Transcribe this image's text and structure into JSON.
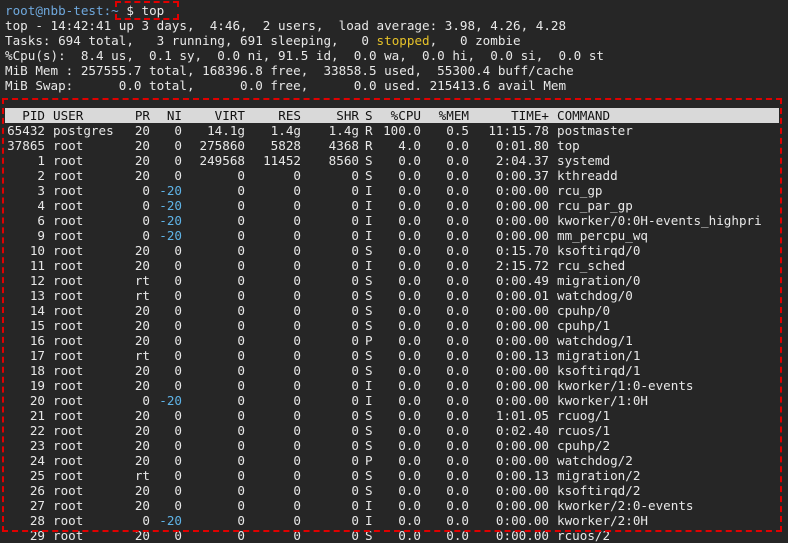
{
  "terminal": {
    "prompt": "root@nbb-test:~",
    "prompt_symbol": "$",
    "command": "top"
  },
  "summary": {
    "line1": "top - 14:42:41 up 3 days,  4:46,  2 users,  load average: 3.98, 4.26, 4.28",
    "line2_a": "Tasks: 694 total,   3 running, 691 sleeping,   0 ",
    "line2_b": "stopped",
    "line2_c": ",   0 zombie",
    "line3": "%Cpu(s):  8.4 us,  0.1 sy,  0.0 ni, 91.5 id,  0.0 wa,  0.0 hi,  0.0 si,  0.0 st",
    "line4": "MiB Mem : 257555.7 total, 168396.8 free,  33858.5 used,  55300.4 buff/cache",
    "line5": "MiB Swap:      0.0 total,      0.0 free,      0.0 used. 215413.6 avail Mem"
  },
  "headers": [
    "PID",
    "USER",
    "PR",
    "NI",
    "VIRT",
    "RES",
    "SHR",
    "S",
    "%CPU",
    "%MEM",
    "TIME+",
    "COMMAND"
  ],
  "processes": [
    [
      "65432",
      "postgres",
      "20",
      "0",
      "14.1g",
      "1.4g",
      "1.4g",
      "R",
      "100.0",
      "0.5",
      "11:15.78",
      "postmaster"
    ],
    [
      "37865",
      "root",
      "20",
      "0",
      "275860",
      "5828",
      "4368",
      "R",
      "4.0",
      "0.0",
      "0:01.80",
      "top"
    ],
    [
      "1",
      "root",
      "20",
      "0",
      "249568",
      "11452",
      "8560",
      "S",
      "0.0",
      "0.0",
      "2:04.37",
      "systemd"
    ],
    [
      "2",
      "root",
      "20",
      "0",
      "0",
      "0",
      "0",
      "S",
      "0.0",
      "0.0",
      "0:00.37",
      "kthreadd"
    ],
    [
      "3",
      "root",
      "0",
      "-20",
      "0",
      "0",
      "0",
      "I",
      "0.0",
      "0.0",
      "0:00.00",
      "rcu_gp"
    ],
    [
      "4",
      "root",
      "0",
      "-20",
      "0",
      "0",
      "0",
      "I",
      "0.0",
      "0.0",
      "0:00.00",
      "rcu_par_gp"
    ],
    [
      "6",
      "root",
      "0",
      "-20",
      "0",
      "0",
      "0",
      "I",
      "0.0",
      "0.0",
      "0:00.00",
      "kworker/0:0H-events_highpri"
    ],
    [
      "9",
      "root",
      "0",
      "-20",
      "0",
      "0",
      "0",
      "I",
      "0.0",
      "0.0",
      "0:00.00",
      "mm_percpu_wq"
    ],
    [
      "10",
      "root",
      "20",
      "0",
      "0",
      "0",
      "0",
      "S",
      "0.0",
      "0.0",
      "0:15.70",
      "ksoftirqd/0"
    ],
    [
      "11",
      "root",
      "20",
      "0",
      "0",
      "0",
      "0",
      "I",
      "0.0",
      "0.0",
      "2:15.72",
      "rcu_sched"
    ],
    [
      "12",
      "root",
      "rt",
      "0",
      "0",
      "0",
      "0",
      "S",
      "0.0",
      "0.0",
      "0:00.49",
      "migration/0"
    ],
    [
      "13",
      "root",
      "rt",
      "0",
      "0",
      "0",
      "0",
      "S",
      "0.0",
      "0.0",
      "0:00.01",
      "watchdog/0"
    ],
    [
      "14",
      "root",
      "20",
      "0",
      "0",
      "0",
      "0",
      "S",
      "0.0",
      "0.0",
      "0:00.00",
      "cpuhp/0"
    ],
    [
      "15",
      "root",
      "20",
      "0",
      "0",
      "0",
      "0",
      "S",
      "0.0",
      "0.0",
      "0:00.00",
      "cpuhp/1"
    ],
    [
      "16",
      "root",
      "20",
      "0",
      "0",
      "0",
      "0",
      "P",
      "0.0",
      "0.0",
      "0:00.00",
      "watchdog/1"
    ],
    [
      "17",
      "root",
      "rt",
      "0",
      "0",
      "0",
      "0",
      "S",
      "0.0",
      "0.0",
      "0:00.13",
      "migration/1"
    ],
    [
      "18",
      "root",
      "20",
      "0",
      "0",
      "0",
      "0",
      "S",
      "0.0",
      "0.0",
      "0:00.00",
      "ksoftirqd/1"
    ],
    [
      "19",
      "root",
      "20",
      "0",
      "0",
      "0",
      "0",
      "I",
      "0.0",
      "0.0",
      "0:00.00",
      "kworker/1:0-events"
    ],
    [
      "20",
      "root",
      "0",
      "-20",
      "0",
      "0",
      "0",
      "I",
      "0.0",
      "0.0",
      "0:00.00",
      "kworker/1:0H"
    ],
    [
      "21",
      "root",
      "20",
      "0",
      "0",
      "0",
      "0",
      "S",
      "0.0",
      "0.0",
      "1:01.05",
      "rcuog/1"
    ],
    [
      "22",
      "root",
      "20",
      "0",
      "0",
      "0",
      "0",
      "S",
      "0.0",
      "0.0",
      "0:02.40",
      "rcuos/1"
    ],
    [
      "23",
      "root",
      "20",
      "0",
      "0",
      "0",
      "0",
      "S",
      "0.0",
      "0.0",
      "0:00.00",
      "cpuhp/2"
    ],
    [
      "24",
      "root",
      "20",
      "0",
      "0",
      "0",
      "0",
      "P",
      "0.0",
      "0.0",
      "0:00.00",
      "watchdog/2"
    ],
    [
      "25",
      "root",
      "rt",
      "0",
      "0",
      "0",
      "0",
      "S",
      "0.0",
      "0.0",
      "0:00.13",
      "migration/2"
    ],
    [
      "26",
      "root",
      "20",
      "0",
      "0",
      "0",
      "0",
      "S",
      "0.0",
      "0.0",
      "0:00.00",
      "ksoftirqd/2"
    ],
    [
      "27",
      "root",
      "20",
      "0",
      "0",
      "0",
      "0",
      "I",
      "0.0",
      "0.0",
      "0:00.00",
      "kworker/2:0-events"
    ],
    [
      "28",
      "root",
      "0",
      "-20",
      "0",
      "0",
      "0",
      "I",
      "0.0",
      "0.0",
      "0:00.00",
      "kworker/2:0H"
    ],
    [
      "29",
      "root",
      "20",
      "0",
      "0",
      "0",
      "0",
      "S",
      "0.0",
      "0.0",
      "0:00.00",
      "rcuos/2"
    ]
  ],
  "colors": {
    "background": "#262626",
    "text": "#e8e8e8",
    "prompt": "#6fa8dc",
    "stopped": "#e6c229",
    "negative_nice": "#5fb3e6",
    "header_bar": "#d9d9d9",
    "annotation": "#e00000"
  }
}
